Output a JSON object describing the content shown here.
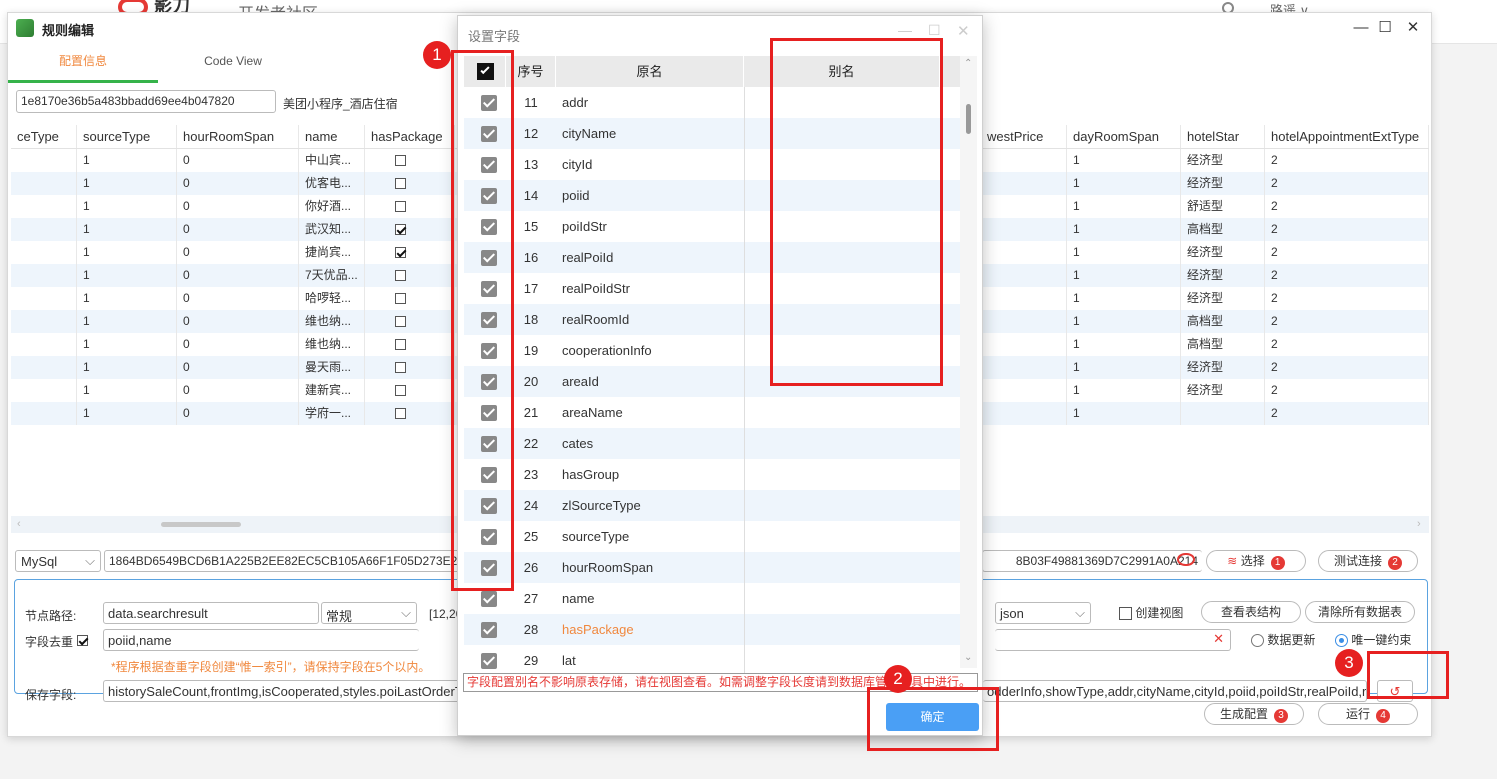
{
  "background": {
    "site_name": "影刀",
    "site_sub": "开发者社区",
    "user": "路遥 ∨"
  },
  "window": {
    "title": "规则编辑",
    "minimize": "—",
    "maximize": "☐",
    "close": "✕"
  },
  "tabs": [
    {
      "label": "配置信息"
    },
    {
      "label": "Code View"
    }
  ],
  "task": {
    "id": "1e8170e36b5a483bbadd69ee4b047820",
    "name": "美团小程序_酒店住宿"
  },
  "grid": {
    "headers_left": [
      "ceType",
      "sourceType",
      "hourRoomSpan",
      "name",
      "hasPackage"
    ],
    "headers_right": [
      "westPrice",
      "dayRoomSpan",
      "hotelStar",
      "hotelAppointmentExtType"
    ],
    "rows": [
      {
        "sourceType": "1",
        "hourRoomSpan": "0",
        "name": "中山宾...",
        "hasPackage": false,
        "dayRoomSpan": "1",
        "hotelStar": "经济型",
        "ext": "2"
      },
      {
        "sourceType": "1",
        "hourRoomSpan": "0",
        "name": "优客电...",
        "hasPackage": false,
        "dayRoomSpan": "1",
        "hotelStar": "经济型",
        "ext": "2"
      },
      {
        "sourceType": "1",
        "hourRoomSpan": "0",
        "name": "你好酒...",
        "hasPackage": false,
        "dayRoomSpan": "1",
        "hotelStar": "舒适型",
        "ext": "2"
      },
      {
        "sourceType": "1",
        "hourRoomSpan": "0",
        "name": "武汉知...",
        "hasPackage": true,
        "dayRoomSpan": "1",
        "hotelStar": "高档型",
        "ext": "2"
      },
      {
        "sourceType": "1",
        "hourRoomSpan": "0",
        "name": "捷尚宾...",
        "hasPackage": true,
        "dayRoomSpan": "1",
        "hotelStar": "经济型",
        "ext": "2"
      },
      {
        "sourceType": "1",
        "hourRoomSpan": "0",
        "name": "7天优品...",
        "hasPackage": false,
        "dayRoomSpan": "1",
        "hotelStar": "经济型",
        "ext": "2"
      },
      {
        "sourceType": "1",
        "hourRoomSpan": "0",
        "name": "哈啰轻...",
        "hasPackage": false,
        "dayRoomSpan": "1",
        "hotelStar": "经济型",
        "ext": "2"
      },
      {
        "sourceType": "1",
        "hourRoomSpan": "0",
        "name": "维也纳...",
        "hasPackage": false,
        "dayRoomSpan": "1",
        "hotelStar": "高档型",
        "ext": "2"
      },
      {
        "sourceType": "1",
        "hourRoomSpan": "0",
        "name": "维也纳...",
        "hasPackage": false,
        "dayRoomSpan": "1",
        "hotelStar": "高档型",
        "ext": "2"
      },
      {
        "sourceType": "1",
        "hourRoomSpan": "0",
        "name": "曼天雨...",
        "hasPackage": false,
        "dayRoomSpan": "1",
        "hotelStar": "经济型",
        "ext": "2"
      },
      {
        "sourceType": "1",
        "hourRoomSpan": "0",
        "name": "建新宾...",
        "hasPackage": false,
        "dayRoomSpan": "1",
        "hotelStar": "经济型",
        "ext": "2"
      },
      {
        "sourceType": "1",
        "hourRoomSpan": "0",
        "name": "学府一...",
        "hasPackage": false,
        "dayRoomSpan": "1",
        "hotelStar": "",
        "ext": "2"
      }
    ]
  },
  "connection": {
    "db_type": "MySql",
    "conn_left": "1864BD6549BCD6B1A225B2EE82EC5CB105A66F1F05D273E2",
    "conn_right": "8B03F49881369D7C2991A0A214",
    "select_label": "选择",
    "select_badge": "1",
    "test_label": "测试连接",
    "test_badge": "2"
  },
  "config": {
    "node_path_label": "节点路径:",
    "node_path_value": "data.searchresult",
    "mode_value": "常规",
    "range_text": "[12,20",
    "format_value": "json",
    "create_view_label": "创建视图",
    "view_struct_label": "查看表结构",
    "clear_label": "清除所有数据表",
    "dedup_label": "字段去重",
    "dedup_value": "poiid,name",
    "radio_update": "数据更新",
    "radio_unique": "唯一键约束",
    "hint": "*程序根据查重字段创建“惟一索引”，请保持字段在5个以内。",
    "save_label": "保存字段:",
    "save_left": "historySaleCount,frontImg,isCooperated,styles.poiLastOrderT",
    "save_right": "odderInfo,showType,addr,cityName,cityId,poiid,poiIdStr,realPoiId,real",
    "gen_label": "生成配置",
    "gen_badge": "3",
    "run_label": "运行",
    "run_badge": "4"
  },
  "dialog": {
    "title": "设置字段",
    "headers": [
      "序号",
      "原名",
      "别名"
    ],
    "rows": [
      {
        "no": "11",
        "name": "addr"
      },
      {
        "no": "12",
        "name": "cityName"
      },
      {
        "no": "13",
        "name": "cityId"
      },
      {
        "no": "14",
        "name": "poiid"
      },
      {
        "no": "15",
        "name": "poiIdStr"
      },
      {
        "no": "16",
        "name": "realPoiId"
      },
      {
        "no": "17",
        "name": "realPoiIdStr"
      },
      {
        "no": "18",
        "name": "realRoomId"
      },
      {
        "no": "19",
        "name": "cooperationInfo"
      },
      {
        "no": "20",
        "name": "areaId"
      },
      {
        "no": "21",
        "name": "areaName"
      },
      {
        "no": "22",
        "name": "cates"
      },
      {
        "no": "23",
        "name": "hasGroup"
      },
      {
        "no": "24",
        "name": "zlSourceType"
      },
      {
        "no": "25",
        "name": "sourceType"
      },
      {
        "no": "26",
        "name": "hourRoomSpan"
      },
      {
        "no": "27",
        "name": "name"
      },
      {
        "no": "28",
        "name": "hasPackage"
      },
      {
        "no": "29",
        "name": "lat"
      }
    ],
    "note": "字段配置别名不影响原表存储，请在视图查看。如需调整字段长度请到数据库管理工具中进行。",
    "ok": "确定"
  },
  "annotations": [
    "1",
    "2",
    "2",
    "3"
  ],
  "colors": {
    "accent": "#f0883e",
    "primary": "#4a9ff5",
    "annotation": "#e62020",
    "tab_underline": "#35b34a"
  }
}
